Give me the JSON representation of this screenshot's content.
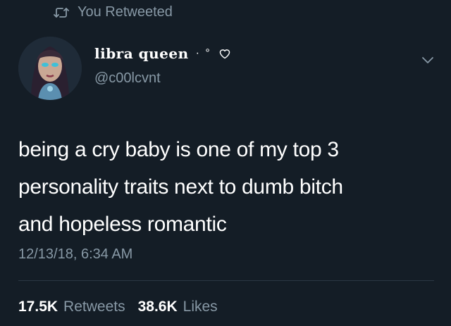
{
  "social_context": {
    "icon": "retweet-icon",
    "text": "You Retweeted"
  },
  "author": {
    "display_name": "libra queen",
    "decoration": "· °",
    "decoration_icon": "heart-outline-icon",
    "handle": "@c00lcvnt",
    "avatar_icon": "doll-avatar"
  },
  "tweet": {
    "lines": [
      "being a cry baby is one of my top 3",
      "personality traits next to dumb bitch",
      "and hopeless romantic"
    ],
    "timestamp": "12/13/18, 6:34 AM"
  },
  "stats": {
    "retweets_count": "17.5K",
    "retweets_label": "Retweets",
    "likes_count": "38.6K",
    "likes_label": "Likes"
  },
  "menu_icon": "chevron-down-icon",
  "colors": {
    "background": "#141d26",
    "text": "#ffffff",
    "secondary": "#8899a6",
    "divider": "#2b3844"
  }
}
